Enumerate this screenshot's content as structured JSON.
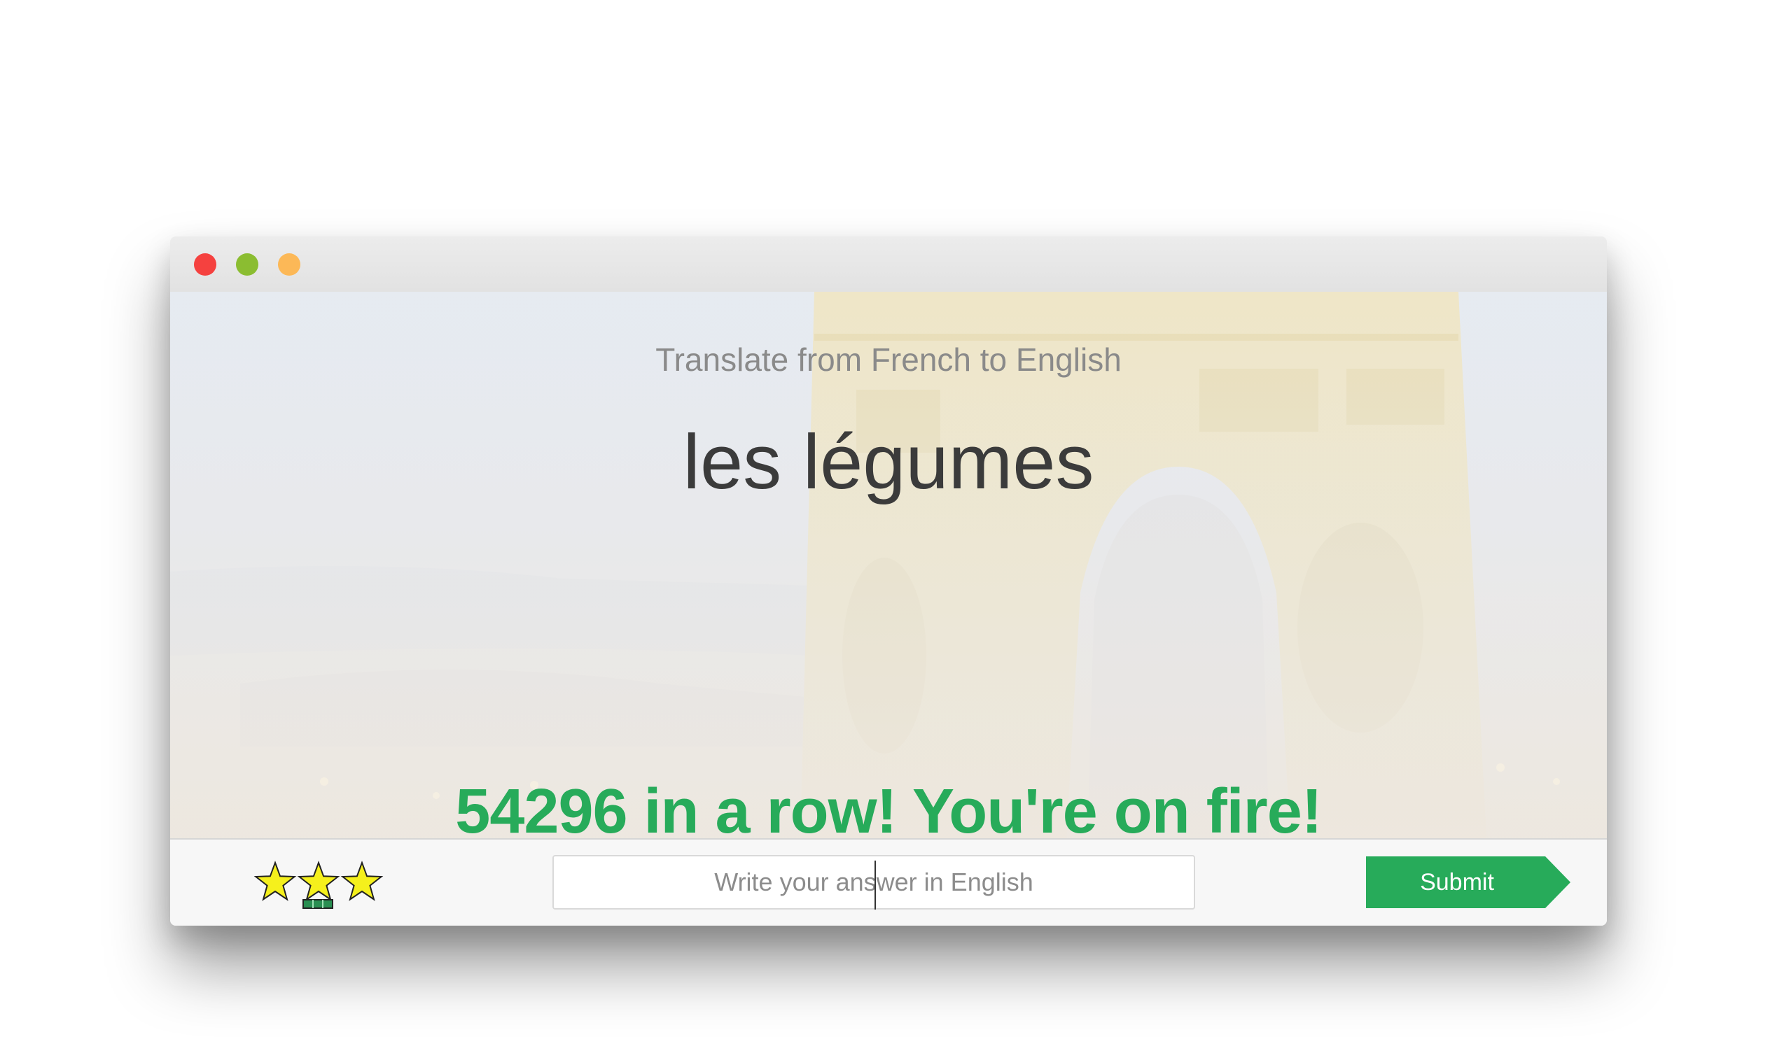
{
  "window": {
    "controls": [
      "close",
      "minimize",
      "maximize"
    ],
    "colors": {
      "close": "#f5413f",
      "minimize": "#8bbd31",
      "maximize": "#fcb857"
    }
  },
  "exercise": {
    "prompt": "Translate from French to English",
    "word": "les légumes"
  },
  "streak": {
    "message": "54296 in a row! You're on fire!"
  },
  "footer": {
    "star_rating": 3,
    "star_max": 3,
    "answer_placeholder": "Write your answer in English",
    "answer_value": "",
    "submit_label": "Submit"
  },
  "colors": {
    "accent_green": "#27ab5a",
    "star_yellow": "#f5f01c"
  }
}
